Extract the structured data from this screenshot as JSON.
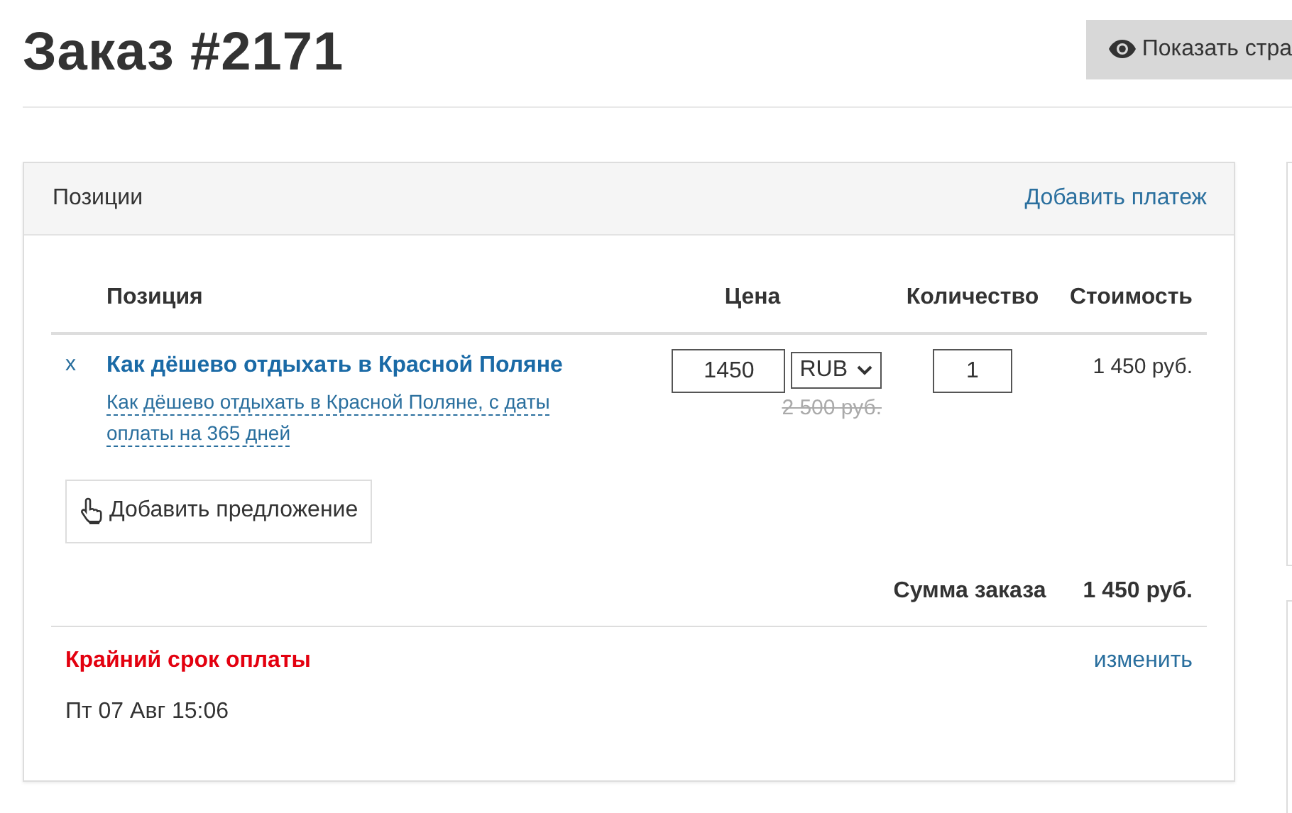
{
  "page": {
    "title": "Заказ #2171",
    "preview_button": "Показать стра"
  },
  "positions_card": {
    "title": "Позиции",
    "add_payment": "Добавить платеж",
    "columns": [
      "Позиция",
      "Цена",
      "Количество",
      "Стоимость"
    ],
    "rows": [
      {
        "remove": "x",
        "name": "Как дёшево отдыхать в Красной Поляне",
        "offer": "Как дёшево отдыхать в Красной Поляне, с даты оплаты на 365 дней",
        "price": "1450",
        "currency": "RUB",
        "old_price": "2 500 руб.",
        "quantity": "1",
        "cost": "1 450 руб."
      }
    ],
    "add_offer": "Добавить предложение",
    "total_label": "Сумма заказа",
    "total": "1 450 руб.",
    "deadline_label": "Крайний срок оплаты",
    "deadline_change": "изменить",
    "deadline": "Пт 07 Авг 15:06"
  }
}
